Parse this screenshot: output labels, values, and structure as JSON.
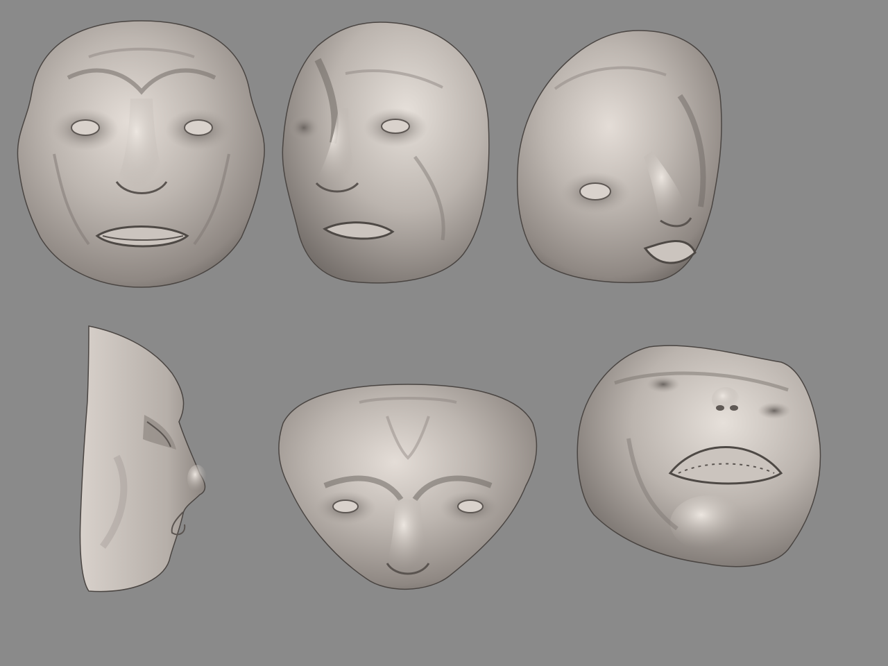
{
  "scene": {
    "background_color": "#8a8a8a",
    "surface_color": "#b5aea8",
    "shadow_color": "#5e5955",
    "highlight_color": "#e2dcd6",
    "views": [
      {
        "id": "front"
      },
      {
        "id": "three-quarter-left"
      },
      {
        "id": "three-quarter-right-tilted"
      },
      {
        "id": "profile-right"
      },
      {
        "id": "top-down"
      },
      {
        "id": "bottom-up"
      }
    ]
  }
}
